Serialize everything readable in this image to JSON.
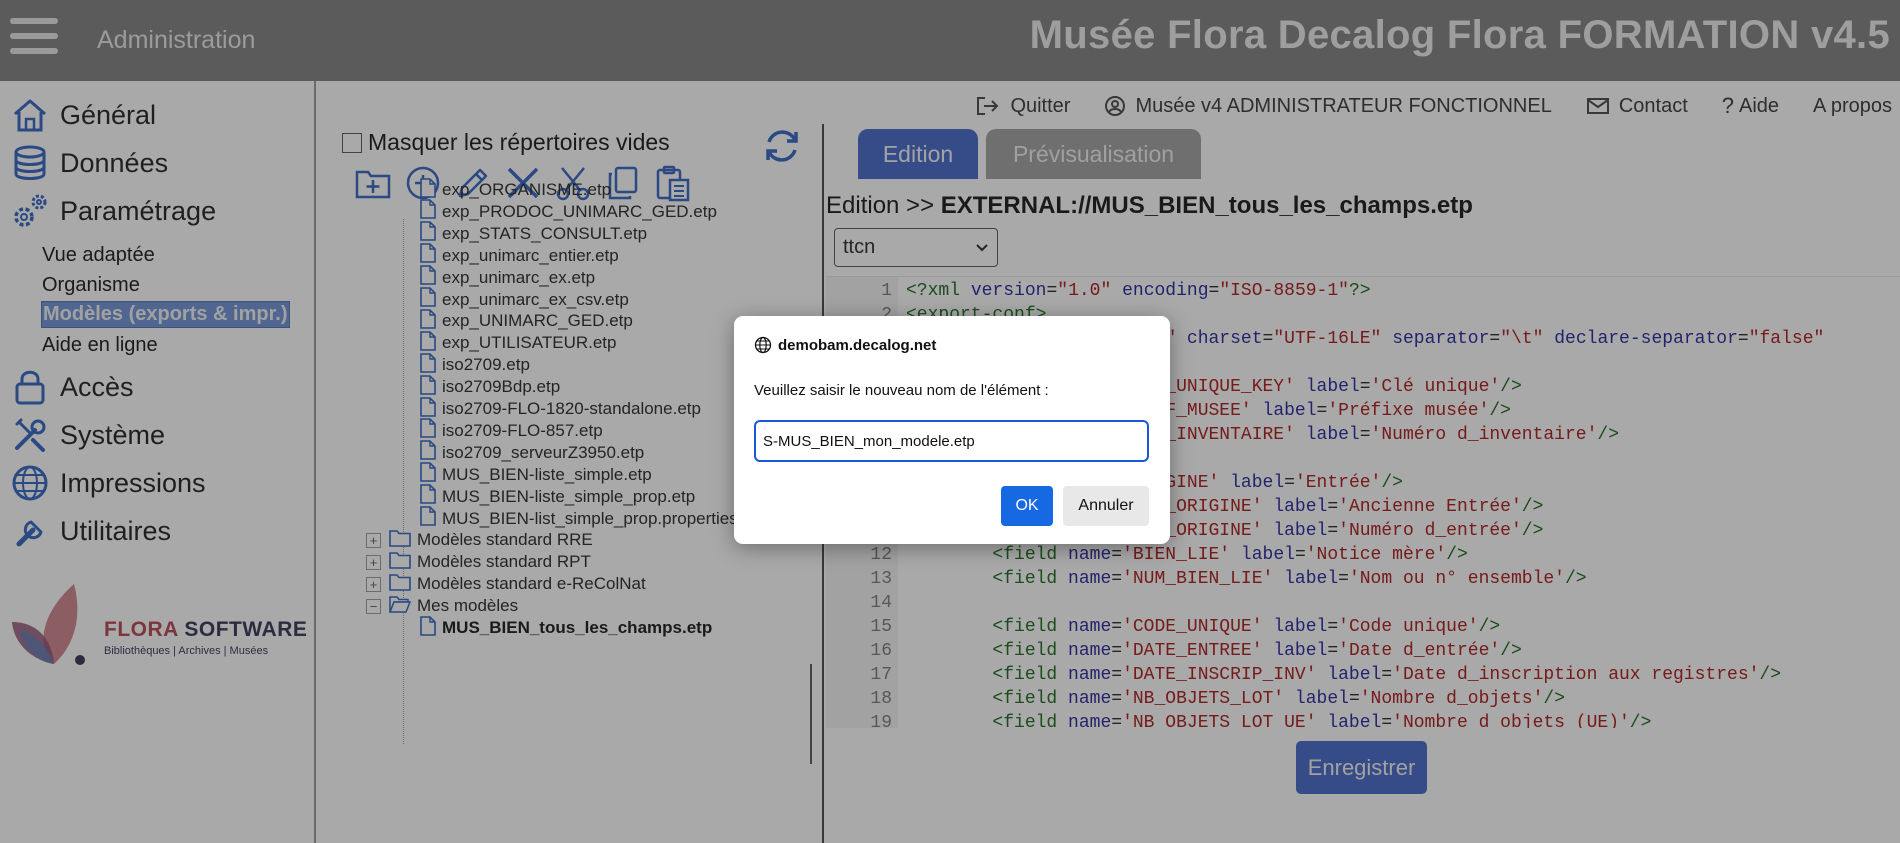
{
  "header": {
    "section_label": "Administration",
    "app_title": "Musée Flora Decalog Flora FORMATION v4.5"
  },
  "top_links": {
    "quit": "Quitter",
    "user": "Musée v4 ADMINISTRATEUR FONCTIONNEL",
    "contact": "Contact",
    "help": "Aide",
    "about": "A propos"
  },
  "nav": {
    "general": "Général",
    "data": "Données",
    "settings": "Paramétrage",
    "sub": {
      "view": "Vue adaptée",
      "org": "Organisme",
      "models": "Modèles (exports & impr.)",
      "help": "Aide en ligne"
    },
    "access": "Accès",
    "system": "Système",
    "prints": "Impressions",
    "utilities": "Utilitaires"
  },
  "logo": {
    "name_a": "FLORA",
    "name_b": " SOFTWARE",
    "tagline": "Bibliothèques | Archives | Musées"
  },
  "tree": {
    "hide_empty_label": "Masquer les répertoires vides",
    "files": [
      "exp_ORGANISME.etp",
      "exp_PRODOC_UNIMARC_GED.etp",
      "exp_STATS_CONSULT.etp",
      "exp_unimarc_entier.etp",
      "exp_unimarc_ex.etp",
      "exp_unimarc_ex_csv.etp",
      "exp_UNIMARC_GED.etp",
      "exp_UTILISATEUR.etp",
      "iso2709.etp",
      "iso2709Bdp.etp",
      "iso2709-FLO-1820-standalone.etp",
      "iso2709-FLO-857.etp",
      "iso2709_serveurZ3950.etp",
      "MUS_BIEN-liste_simple.etp",
      "MUS_BIEN-liste_simple_prop.etp",
      "MUS_BIEN-list_simple_prop.properties"
    ],
    "folders": [
      {
        "label": "Modèles standard RRE",
        "expander": "+"
      },
      {
        "label": "Modèles standard RPT",
        "expander": "+"
      },
      {
        "label": "Modèles standard e-ReColNat",
        "expander": "+"
      },
      {
        "label": "Mes modèles",
        "expander": "−"
      }
    ],
    "my_models_file": "MUS_BIEN_tous_les_champs.etp"
  },
  "editor": {
    "tab_edit": "Edition",
    "tab_preview": "Prévisualisation",
    "breadcrumb_prefix": "Edition >> ",
    "breadcrumb_path": "EXTERNAL://MUS_BIEN_tous_les_champs.etp",
    "encoding": "ttcn",
    "save_label": "Enregistrer",
    "lines": [
      {
        "n": "1",
        "html": "<span class='tg'>&lt;?xml</span> <span class='at'>version</span>=<span class='vs'>\"1.0\"</span> <span class='at'>encoding</span>=<span class='vs'>\"ISO-8859-1\"</span><span class='tg'>?&gt;</span>"
      },
      {
        "n": "2",
        "html": "<span class='tg'>&lt;export-conf&gt;</span>"
      },
      {
        "n": "3",
        "html": "<span class='tg'>  &lt;format</span> <span class='at'>name</span>=<span class='vs'>\"MUS_BIEN\"</span> <span class='at'>charset</span>=<span class='vs'>\"UTF-16LE\"</span> <span class='at'>separator</span>=<span class='vs'>\"\\t\"</span> <span class='at'>declare-separator</span>=<span class='vs'>\"false\"</span>"
      },
      {
        "n": "4",
        "html": ""
      },
      {
        "n": "5",
        "html": "<span class='tg'>        &lt;field</span> <span class='at'>name</span>=<span class='vs'>'CLE_UNIQUE_KEY'</span> <span class='at'>label</span>=<span class='vs'>'Clé unique'</span><span class='tg'>/&gt;</span>"
      },
      {
        "n": "6",
        "html": "<span class='tg'>        &lt;field</span> <span class='at'>name</span>=<span class='vs'>'PREF_MUSEE'</span> <span class='at'>label</span>=<span class='vs'>'Préfixe musée'</span><span class='tg'>/&gt;</span>"
      },
      {
        "n": "7",
        "html": "<span class='tg'>        &lt;field</span> <span class='at'>name</span>=<span class='vs'>'NUM_INVENTAIRE'</span> <span class='at'>label</span>=<span class='vs'>'Numéro d_inventaire'</span><span class='tg'>/&gt;</span>"
      },
      {
        "n": "8",
        "html": ""
      },
      {
        "n": "9",
        "html": "<span class='tg'>        &lt;field</span> <span class='at'>name</span>=<span class='vs'>'ORIGINE'</span> <span class='at'>label</span>=<span class='vs'>'Entrée'</span><span class='tg'>/&gt;</span>"
      },
      {
        "n": "10",
        "html": "<span class='tg'>        &lt;field</span> <span class='at'>name</span>=<span class='vs'>'ANC_ORIGINE'</span> <span class='at'>label</span>=<span class='vs'>'Ancienne Entrée'</span><span class='tg'>/&gt;</span>"
      },
      {
        "n": "11",
        "html": "<span class='tg'>        &lt;field</span> <span class='at'>name</span>=<span class='vs'>'NUM_ORIGINE'</span> <span class='at'>label</span>=<span class='vs'>'Numéro d_entrée'</span><span class='tg'>/&gt;</span>"
      },
      {
        "n": "12",
        "html": "<span class='tg'>        &lt;field</span> <span class='at'>name</span>=<span class='vs'>'BIEN_LIE'</span> <span class='at'>label</span>=<span class='vs'>'Notice mère'</span><span class='tg'>/&gt;</span>"
      },
      {
        "n": "13",
        "html": "<span class='tg'>        &lt;field</span> <span class='at'>name</span>=<span class='vs'>'NUM_BIEN_LIE'</span> <span class='at'>label</span>=<span class='vs'>'Nom ou n° ensemble'</span><span class='tg'>/&gt;</span>"
      },
      {
        "n": "14",
        "html": ""
      },
      {
        "n": "15",
        "html": "<span class='tg'>        &lt;field</span> <span class='at'>name</span>=<span class='vs'>'CODE_UNIQUE'</span> <span class='at'>label</span>=<span class='vs'>'Code unique'</span><span class='tg'>/&gt;</span>"
      },
      {
        "n": "16",
        "html": "<span class='tg'>        &lt;field</span> <span class='at'>name</span>=<span class='vs'>'DATE_ENTREE'</span> <span class='at'>label</span>=<span class='vs'>'Date d_entrée'</span><span class='tg'>/&gt;</span>"
      },
      {
        "n": "17",
        "html": "<span class='tg'>        &lt;field</span> <span class='at'>name</span>=<span class='vs'>'DATE_INSCRIP_INV'</span> <span class='at'>label</span>=<span class='vs'>'Date d_inscription aux registres'</span><span class='tg'>/&gt;</span>"
      },
      {
        "n": "18",
        "html": "<span class='tg'>        &lt;field</span> <span class='at'>name</span>=<span class='vs'>'NB_OBJETS_LOT'</span> <span class='at'>label</span>=<span class='vs'>'Nombre d_objets'</span><span class='tg'>/&gt;</span>"
      },
      {
        "n": "19",
        "html": "<span class='tg'>        &lt;field</span> <span class='at'>name</span>=<span class='vs'>'NB_OBJETS_LOT_UE'</span> <span class='at'>label</span>=<span class='vs'>'Nombre d_objets (UE)'</span><span class='tg'>/&gt;</span>"
      }
    ]
  },
  "dialog": {
    "origin": "demobam.decalog.net",
    "message": "Veuillez saisir le nouveau nom de l'élément :",
    "input_value": "S-MUS_BIEN_mon_modele.etp",
    "ok_label": "OK",
    "cancel_label": "Annuler"
  },
  "colors": {
    "header_bg": "#7d7d7d",
    "accent": "#3e64c8",
    "icon_blue": "#2d5fbf",
    "dialog_ok": "#1668e3"
  }
}
